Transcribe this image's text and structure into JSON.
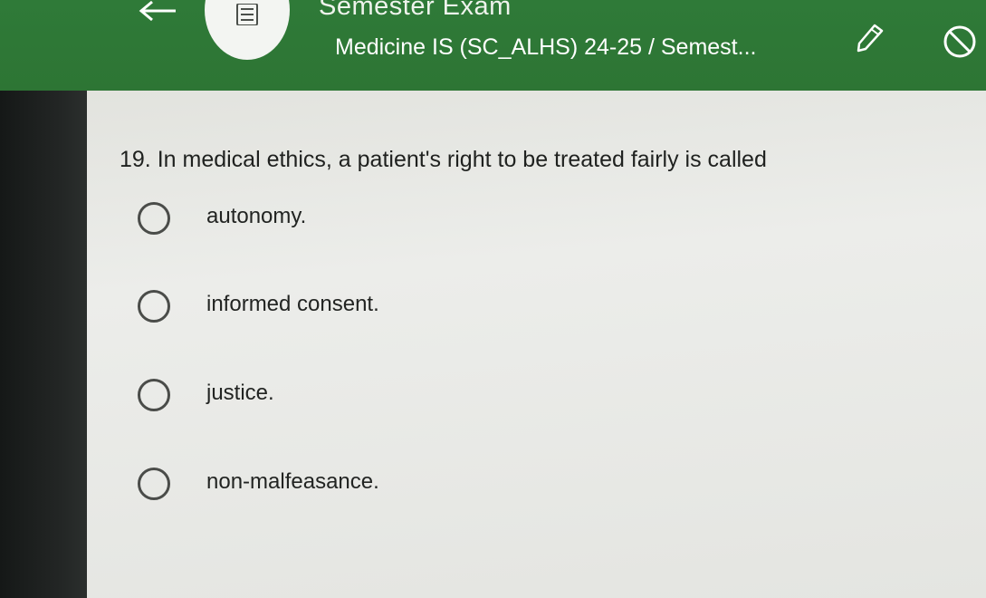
{
  "header": {
    "title": "Semester Exam",
    "subtitle": "Medicine IS (SC_ALHS) 24-25 / Semest...",
    "icons": {
      "back": "arrow-left-icon",
      "menu": "list-icon",
      "pencil": "pencil-icon",
      "block": "block-icon"
    },
    "accent_color": "#2e7836"
  },
  "question": {
    "text": "19. In medical ethics, a patient's right to be treated fairly is called",
    "options": [
      {
        "label": "autonomy."
      },
      {
        "label": "informed consent."
      },
      {
        "label": "justice."
      },
      {
        "label": "non-malfeasance."
      }
    ]
  }
}
